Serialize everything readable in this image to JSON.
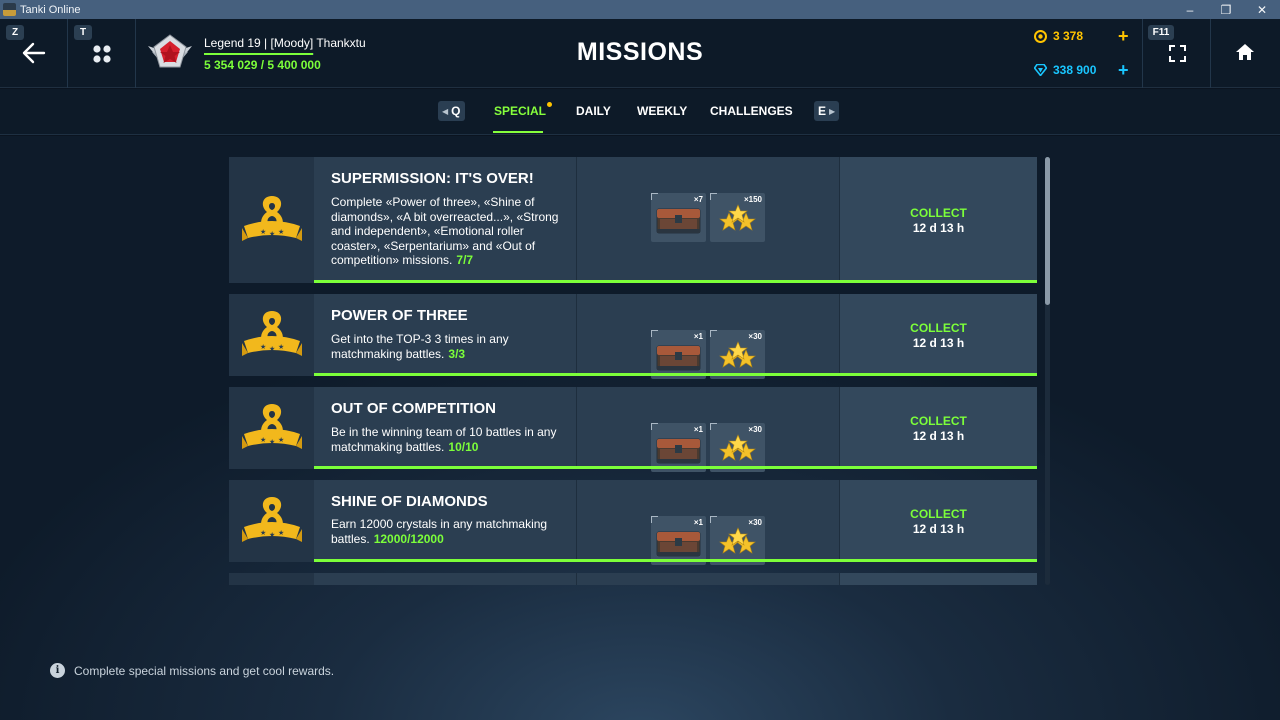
{
  "window": {
    "title": "Tanki Online",
    "controls": [
      "–",
      "❐",
      "✕"
    ]
  },
  "header": {
    "back_key": "Z",
    "menu_key": "T",
    "player_name": "Legend 19 | [Moody] Thankxtu",
    "xp_text": "5 354 029 / 5 400 000",
    "xp_progress": 0.9915,
    "title": "MISSIONS",
    "crystals_gold": "3 378",
    "crystals_blue": "338 900",
    "fullscreen_key": "F11",
    "accent_gold": "#ffc400",
    "accent_blue": "#19c6ff",
    "accent_green": "#7cff3a"
  },
  "tabs": {
    "prev_key": "Q",
    "next_key": "E",
    "items": [
      {
        "label": "SPECIAL",
        "active": true
      },
      {
        "label": "DAILY",
        "active": false
      },
      {
        "label": "WEEKLY",
        "active": false
      },
      {
        "label": "CHALLENGES",
        "active": false
      }
    ]
  },
  "missions": [
    {
      "title": "SUPERMISSION: IT'S OVER!",
      "description": "Complete «Power of three», «Shine of diamonds», «A bit overreacted...», «Strong and independent», «Emotional roller coaster», «Serpentarium» and «Out of competition» missions.",
      "count": "7/7",
      "rewards": [
        {
          "icon": "container-icon",
          "qty": "×7"
        },
        {
          "icon": "stars-icon",
          "qty": "×150"
        }
      ],
      "collect": "COLLECT",
      "time": "12 d 13 h",
      "progress": 1.0
    },
    {
      "title": "POWER OF THREE",
      "description": "Get into the TOP-3 3 times in any matchmaking battles.",
      "count": "3/3",
      "rewards": [
        {
          "icon": "container-icon",
          "qty": "×1"
        },
        {
          "icon": "stars-icon",
          "qty": "×30"
        }
      ],
      "collect": "COLLECT",
      "time": "12 d 13 h",
      "progress": 1.0
    },
    {
      "title": "OUT OF COMPETITION",
      "description": "Be in the winning team of 10 battles in any matchmaking battles.",
      "count": "10/10",
      "rewards": [
        {
          "icon": "container-icon",
          "qty": "×1"
        },
        {
          "icon": "stars-icon",
          "qty": "×30"
        }
      ],
      "collect": "COLLECT",
      "time": "12 d 13 h",
      "progress": 1.0
    },
    {
      "title": "SHINE OF DIAMONDS",
      "description": "Earn 12000 crystals in any matchmaking battles.",
      "count": "12000/12000",
      "rewards": [
        {
          "icon": "container-icon",
          "qty": "×1"
        },
        {
          "icon": "stars-icon",
          "qty": "×30"
        }
      ],
      "collect": "COLLECT",
      "time": "12 d 13 h",
      "progress": 1.0
    }
  ],
  "hint": "Complete special missions and get cool rewards."
}
